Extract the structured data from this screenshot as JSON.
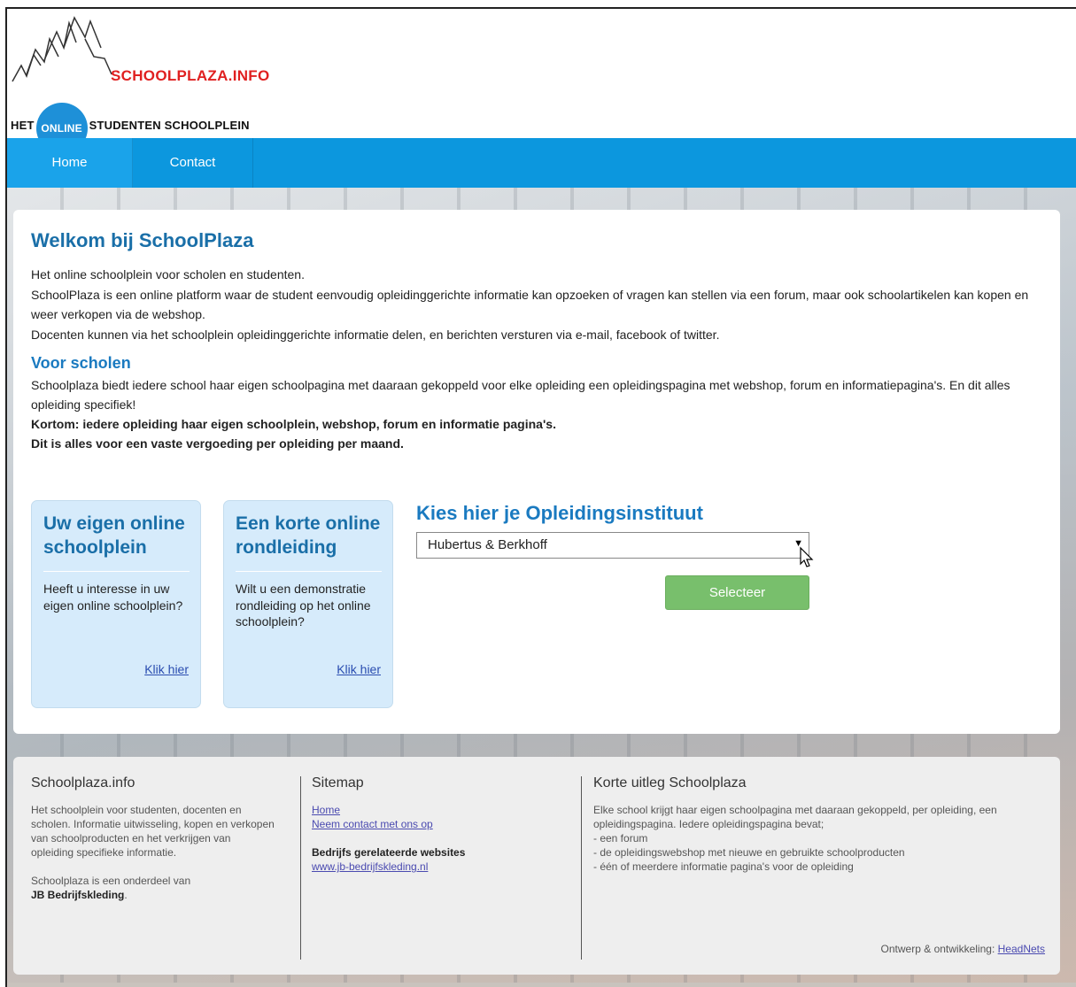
{
  "logo": {
    "title": "SCHOOLPLAZA.INFO",
    "sub_left": "HET",
    "sub_circle": "ONLINE",
    "sub_right": "STUDENTEN SCHOOLPLEIN"
  },
  "nav": {
    "items": [
      {
        "label": "Home"
      },
      {
        "label": "Contact"
      }
    ]
  },
  "main": {
    "title": "Welkom bij SchoolPlaza",
    "intro": [
      "Het online schoolplein voor scholen en studenten.",
      "SchoolPlaza is een online platform waar de student eenvoudig opleidinggerichte informatie kan opzoeken of vragen kan stellen via een forum, maar ook schoolartikelen kan kopen en weer verkopen via de webshop.",
      "Docenten kunnen via het schoolplein opleidinggerichte informatie delen, en berichten versturen via e-mail, facebook of twitter."
    ],
    "scholen_title": "Voor scholen",
    "scholen_text": "Schoolplaza biedt iedere school haar eigen schoolpagina met daaraan gekoppeld voor elke opleiding een opleidingspagina met webshop, forum en informatiepagina's. En dit alles opleiding specifiek!",
    "scholen_bold1": "Kortom: iedere opleiding haar eigen schoolplein, webshop, forum en informatie pagina's.",
    "scholen_bold2": "Dit is alles voor een vaste vergoeding per opleiding per maand."
  },
  "boxes": [
    {
      "title": "Uw eigen online schoolplein",
      "text": "Heeft u interesse in uw eigen online schoolplein?",
      "link": "Klik hier"
    },
    {
      "title": "Een korte online rondleiding",
      "text": "Wilt u een demonstratie rondleiding op het online schoolplein?",
      "link": "Klik hier"
    }
  ],
  "kies": {
    "title": "Kies hier je Opleidingsinstituut",
    "selected": "Hubertus & Berkhoff",
    "button": "Selecteer"
  },
  "footer": {
    "col1": {
      "title": "Schoolplaza.info",
      "text": "Het schoolplein voor studenten, docenten en scholen. Informatie uitwisseling, kopen en verkopen van schoolproducten en het verkrijgen van opleiding specifieke informatie.",
      "part_of": "Schoolplaza is een onderdeel van",
      "part_of_name": "JB Bedrijfskleding",
      "period": "."
    },
    "col2": {
      "title": "Sitemap",
      "links": [
        "Home",
        "Neem contact met ons op"
      ],
      "related_title": "Bedrijfs gerelateerde websites",
      "related_link": "www.jb-bedrijfskleding.nl"
    },
    "col3": {
      "title": "Korte uitleg Schoolplaza",
      "text": "Elke school krijgt haar eigen schoolpagina met daaraan gekoppeld, per opleiding, een opleidingspagina. Iedere opleidingspagina bevat;",
      "bullets": [
        "- een forum",
        "- de opleidingswebshop met nieuwe en gebruikte schoolproducten",
        "- één of meerdere informatie pagina's voor de opleiding"
      ],
      "credit_prefix": "Ontwerp & ontwikkeling:",
      "credit_link": "HeadNets"
    }
  },
  "colors": {
    "nav": "#0c97de",
    "accent_title": "#1a6fa8",
    "button": "#78bf6c",
    "logo_red": "#e02020",
    "logo_blue": "#1e90d8"
  }
}
